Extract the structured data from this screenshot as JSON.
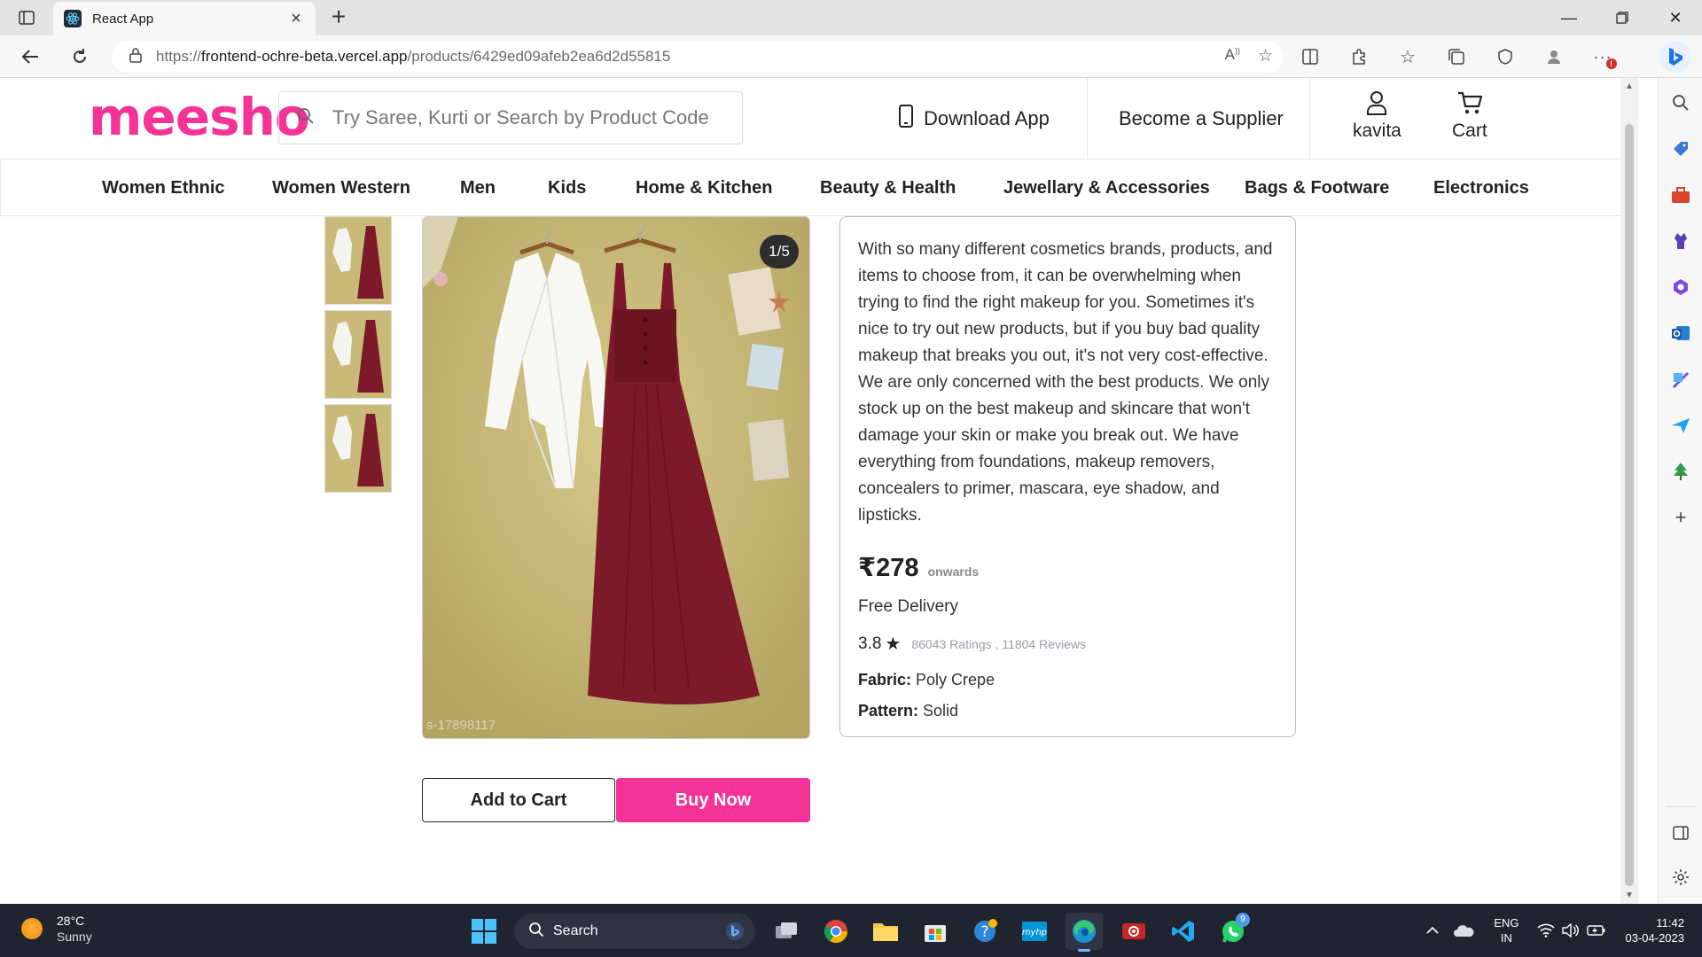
{
  "browser": {
    "tab_title": "React App",
    "url_prefix": "https://",
    "url_host": "frontend-ochre-beta.vercel.app",
    "url_path": "/products/6429ed09afeb2ea6d2d55815"
  },
  "header": {
    "logo": "meesho",
    "search_placeholder": "Try Saree, Kurti or Search by Product Code",
    "download_app": "Download App",
    "become_supplier": "Become a Supplier",
    "user": "kavita",
    "cart": "Cart"
  },
  "categories": [
    "Women Ethnic",
    "Women Western",
    "Men",
    "Kids",
    "Home & Kitchen",
    "Beauty & Health",
    "Jewellary & Accessories",
    "Bags & Footware",
    "Electronics"
  ],
  "product": {
    "image_counter": "1/5",
    "image_code": "s-17898117",
    "description": "With so many different cosmetics brands, products, and items to choose from, it can be overwhelming when trying to find the right makeup for you. Sometimes it's nice to try out new products, but if you buy bad quality makeup that breaks you out, it's not very cost-effective. We are only concerned with the best products. We only stock up on the best makeup and skincare that won't damage your skin or make you break out. We have everything from foundations, makeup removers, concealers to primer, mascara, eye shadow, and lipsticks.",
    "price": "₹278",
    "price_suffix": "onwards",
    "delivery": "Free Delivery",
    "rating": "3.8",
    "rating_counts": "86043 Ratings , 11804 Reviews",
    "fabric_label": "Fabric:",
    "fabric_value": "Poly Crepe",
    "pattern_label": "Pattern:",
    "pattern_value": "Solid",
    "add_to_cart": "Add to Cart",
    "buy_now": "Buy Now"
  },
  "taskbar": {
    "temperature": "28°C",
    "weather": "Sunny",
    "search": "Search",
    "whatsapp_badge": "9",
    "lang_line1": "ENG",
    "lang_line2": "IN",
    "time": "11:42",
    "date": "03-04-2023"
  },
  "colors": {
    "brand": "#f43397",
    "dress_maroon": "#7d1a2a",
    "wall": "#c9ba7a"
  }
}
